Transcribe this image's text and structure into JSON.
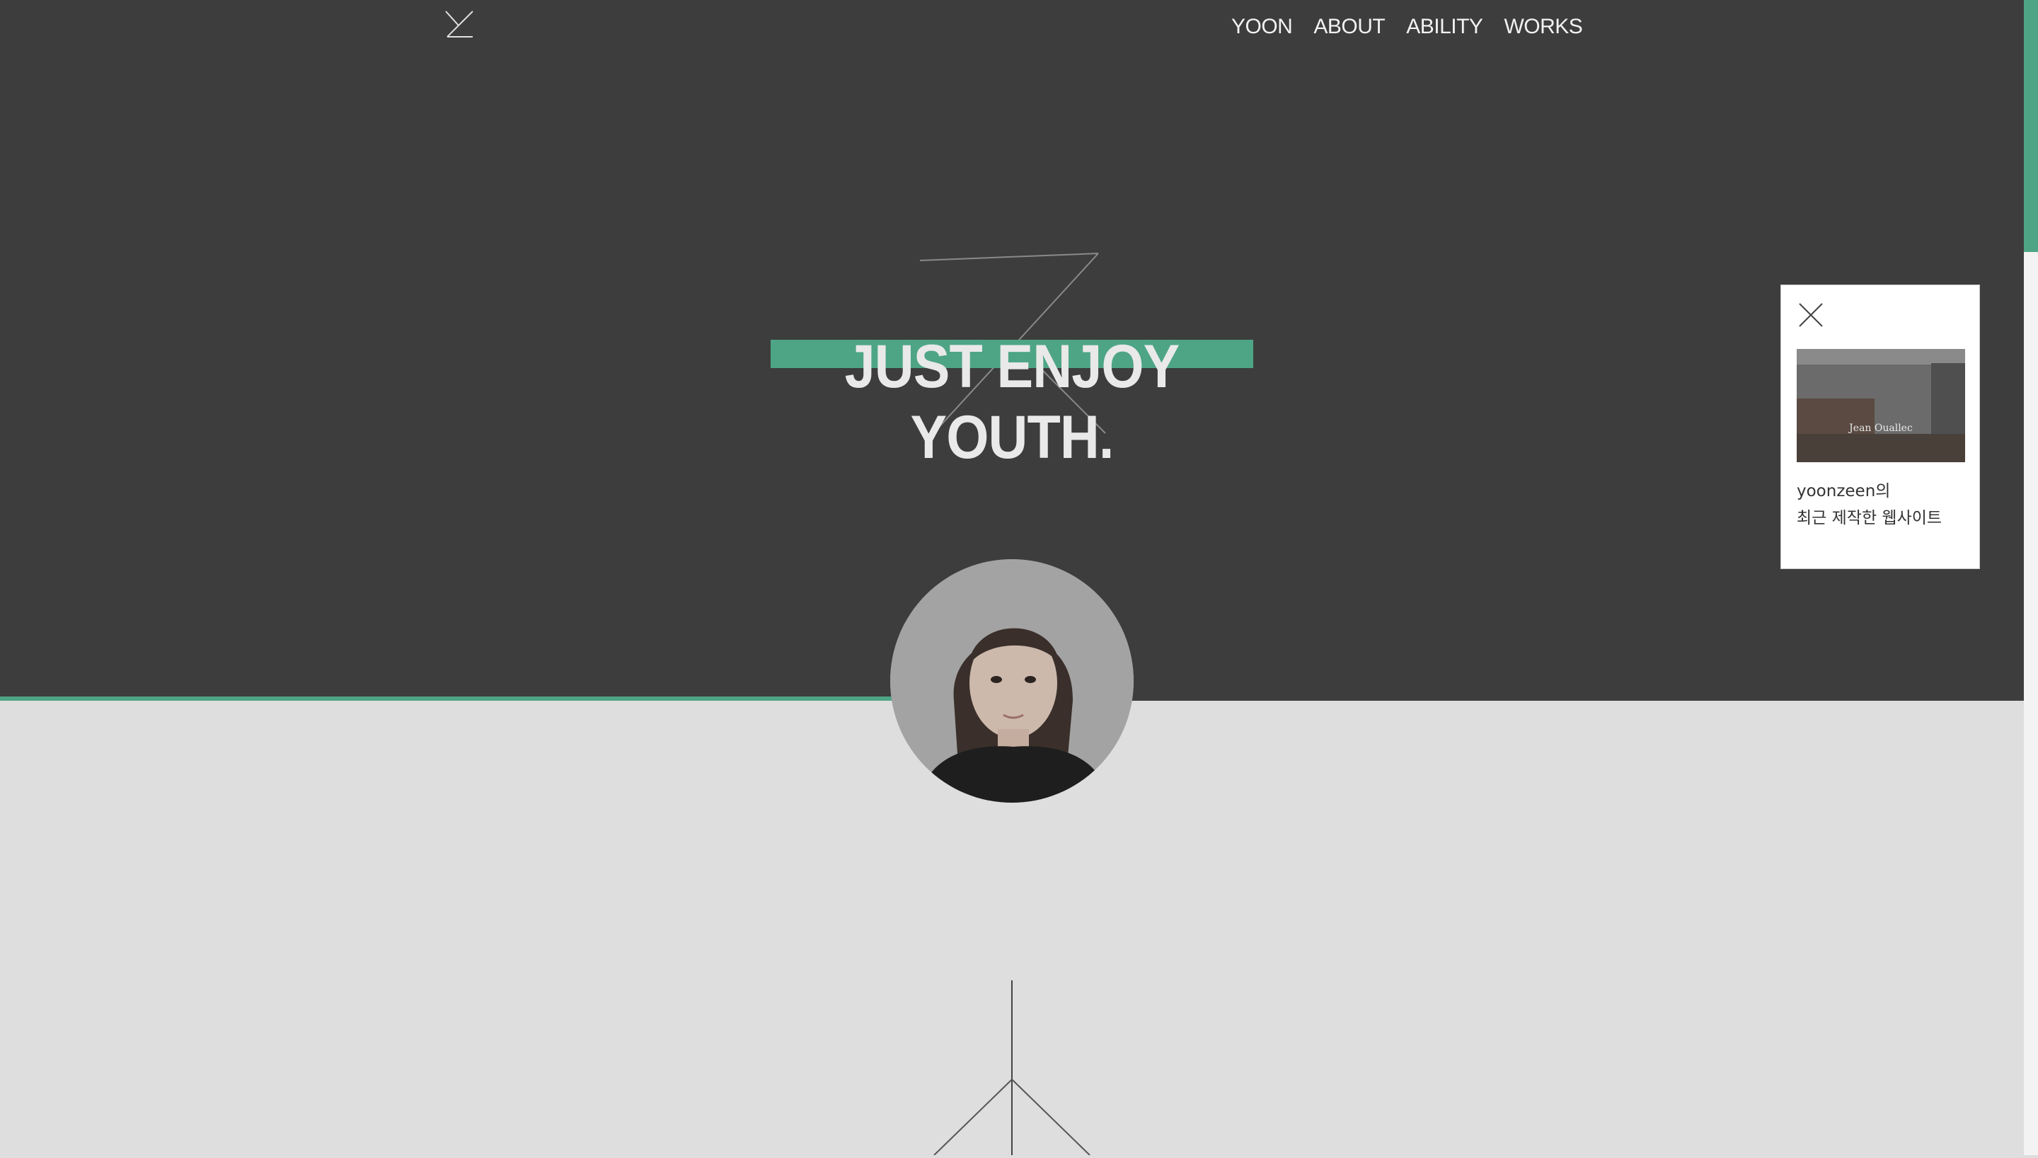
{
  "nav": {
    "items": [
      "YOON",
      "ABOUT",
      "ABILITY",
      "WORKS"
    ]
  },
  "hero": {
    "headline": "JUST ENJOY YOUTH."
  },
  "popup": {
    "line1": "yoonzeen의",
    "line2": "최근 제작한 웹사이트",
    "thumbnail_caption": "Jean Ouallec"
  },
  "colors": {
    "accent": "#4ea586",
    "hero_bg": "#3d3d3d",
    "page_bg": "#dedede"
  },
  "scrollbar": {
    "scroll_progress": 0.0
  }
}
